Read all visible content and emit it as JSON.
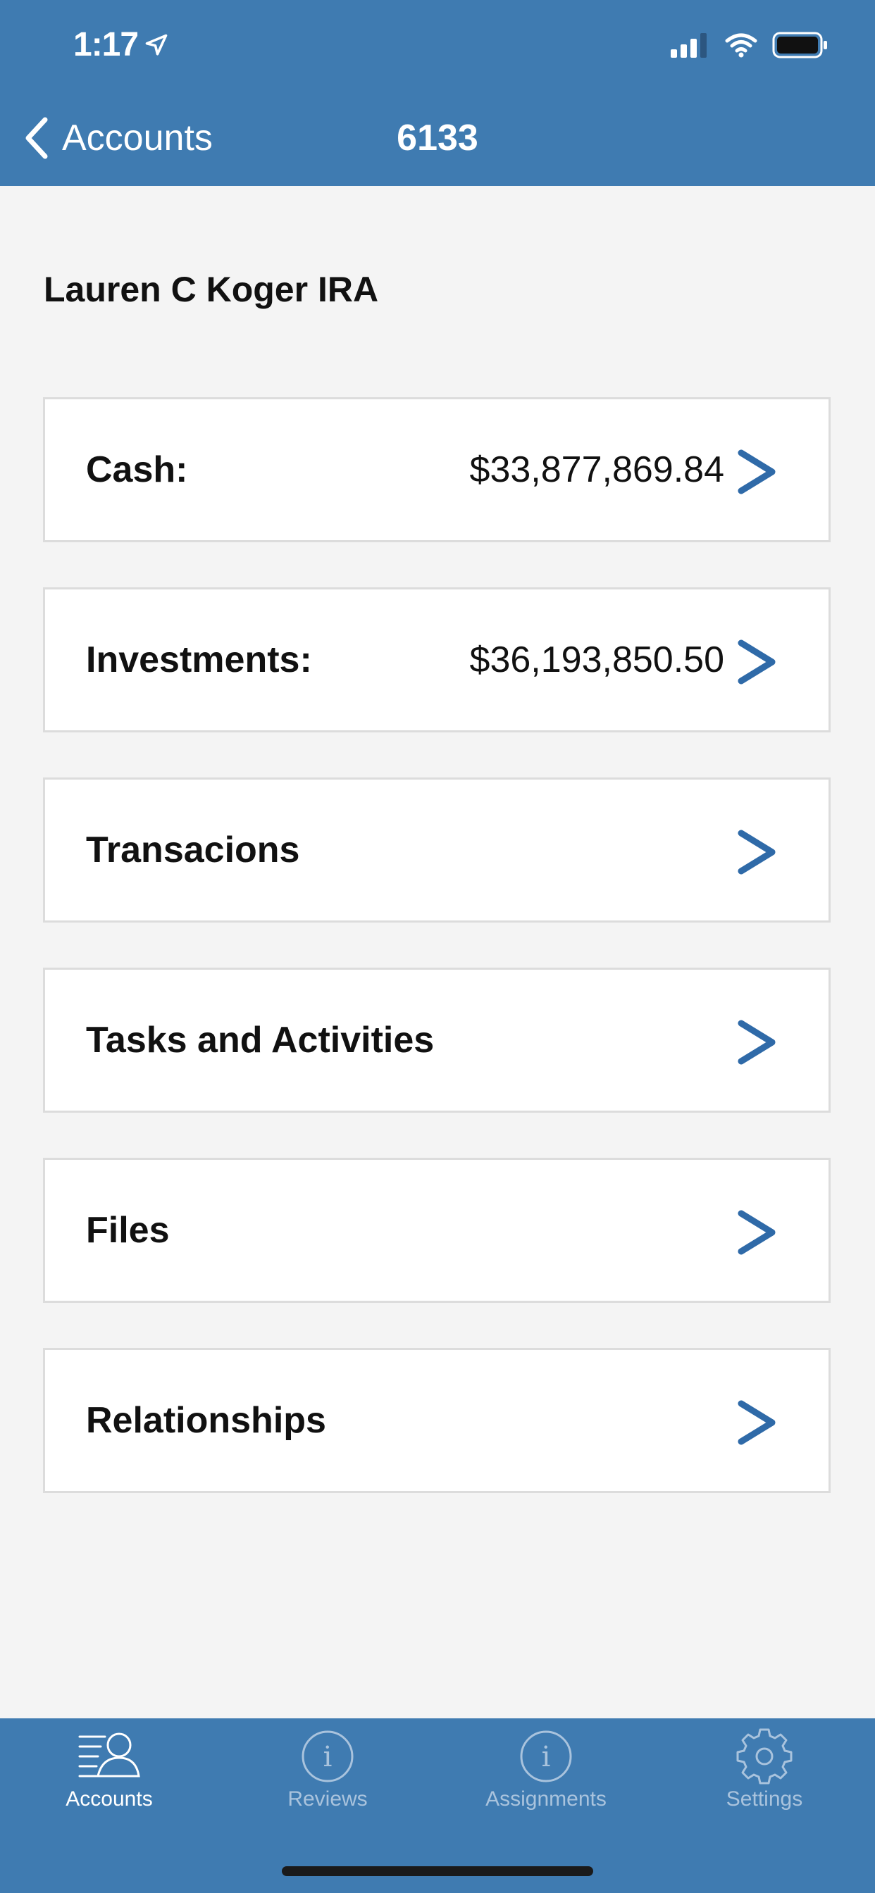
{
  "status_bar": {
    "time": "1:17"
  },
  "nav": {
    "back_label": "Accounts",
    "title": "6133"
  },
  "account": {
    "name": "Lauren C Koger IRA"
  },
  "rows": [
    {
      "label": "Cash:",
      "value": "$33,877,869.84"
    },
    {
      "label": "Investments:",
      "value": "$36,193,850.50"
    },
    {
      "label": "Transacions",
      "value": ""
    },
    {
      "label": "Tasks and Activities",
      "value": ""
    },
    {
      "label": "Files",
      "value": ""
    },
    {
      "label": "Relationships",
      "value": ""
    }
  ],
  "tabs": [
    {
      "label": "Accounts",
      "icon": "accounts-icon",
      "active": true
    },
    {
      "label": "Reviews",
      "icon": "info-icon",
      "active": false
    },
    {
      "label": "Assignments",
      "icon": "info-icon",
      "active": false
    },
    {
      "label": "Settings",
      "icon": "gear-icon",
      "active": false
    }
  ],
  "colors": {
    "brand": "#3f7bb1",
    "chevron": "#2f6aa8",
    "background": "#f4f4f4"
  }
}
